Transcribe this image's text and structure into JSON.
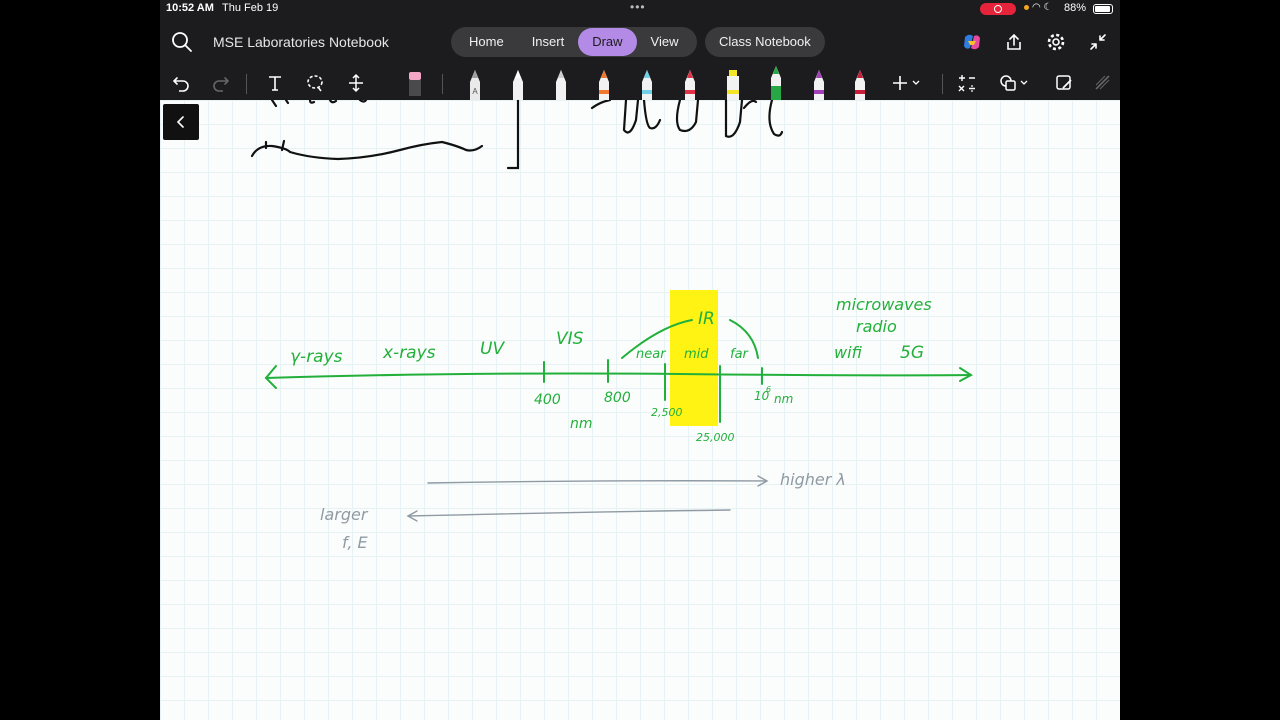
{
  "status_bar": {
    "time": "10:52 AM",
    "date": "Thu Feb 19",
    "battery": "88%"
  },
  "app": {
    "notebook_title": "MSE Laboratories Notebook",
    "tabs": [
      {
        "label": "Home",
        "active": false
      },
      {
        "label": "Insert",
        "active": false
      },
      {
        "label": "Draw",
        "active": true
      },
      {
        "label": "View",
        "active": false
      }
    ],
    "class_notebook_label": "Class Notebook",
    "accent_color": "#b38be6"
  },
  "toolbar": {
    "tools": [
      "undo-icon",
      "redo-icon",
      "text-icon",
      "lasso-icon",
      "add-space-icon",
      "eraser-icon"
    ],
    "pens": [
      {
        "name": "pen-gray",
        "color": "#9e9e9e"
      },
      {
        "name": "pen-white",
        "color": "#ffffff"
      },
      {
        "name": "pen-silver",
        "color": "#d9d9d9"
      },
      {
        "name": "pen-orange",
        "color": "#f0772b"
      },
      {
        "name": "pen-light-blue",
        "color": "#6fd0e8"
      },
      {
        "name": "pen-red",
        "color": "#e03347"
      },
      {
        "name": "highlighter-yellow",
        "color": "#f2e627"
      },
      {
        "name": "pen-green",
        "color": "#27a844"
      },
      {
        "name": "pen-purple",
        "color": "#a33fb8"
      },
      {
        "name": "pen-crimson",
        "color": "#c81e3a"
      }
    ]
  },
  "canvas": {
    "ink_green": "#22b03a",
    "highlight_yellow": "#fff200",
    "ink_gray": "#8f9aa3",
    "spectrum_labels": {
      "gamma": "γ-rays",
      "xrays": "x-rays",
      "uv": "UV",
      "vis": "VIS",
      "ir": "IR",
      "near": "near",
      "mid": "mid",
      "far": "far",
      "microwaves": "microwaves",
      "radio": "radio",
      "wifi": "wifi",
      "fiveg": "5G"
    },
    "tick_labels": {
      "t400": "400",
      "t800": "800",
      "nm1": "nm",
      "t2500": "2,500",
      "t25000": "25,000",
      "t10": "10",
      "t10exp": "6",
      "nm2": "nm"
    },
    "arrow_notes": {
      "higher": "higher λ",
      "larger_line1": "larger",
      "larger_line2": "f, E"
    }
  }
}
